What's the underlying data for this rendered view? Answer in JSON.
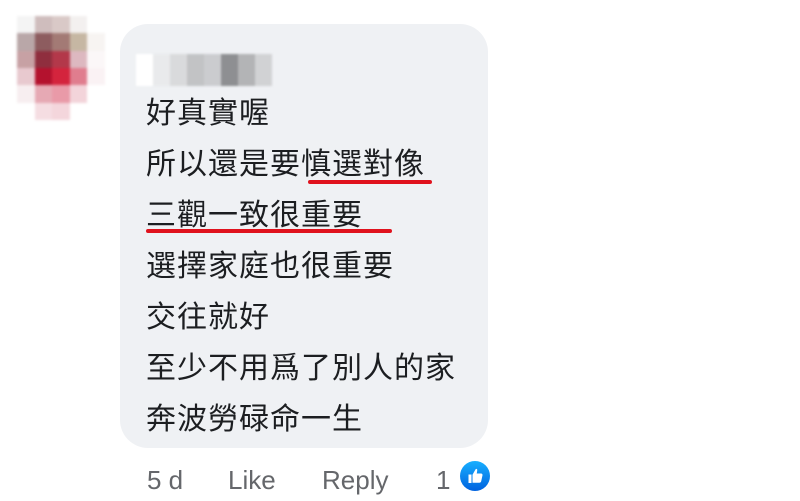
{
  "comment": {
    "lines": [
      "好真實喔",
      "所以還是要慎選對像",
      "三觀一致很重要",
      "選擇家庭也很重要",
      "交往就好",
      "至少不用爲了別人的家",
      "奔波勞碌命一生"
    ],
    "highlights": [
      {
        "line": 1,
        "text": "慎選對像"
      },
      {
        "line": 2,
        "text": "三觀一致很重要"
      }
    ]
  },
  "actions": {
    "time": "5 d",
    "like_label": "Like",
    "reply_label": "Reply",
    "reaction_count": "1"
  },
  "icons": {
    "avatar": "blurred-avatar",
    "username": "blurred-username",
    "reaction": "like-thumbs-up-icon"
  },
  "colors": {
    "bubble": "#eff1f4",
    "text": "#1c1e21",
    "meta": "#65676b",
    "highlight_underline": "#e0121d",
    "like_blue": "#1877f2"
  }
}
